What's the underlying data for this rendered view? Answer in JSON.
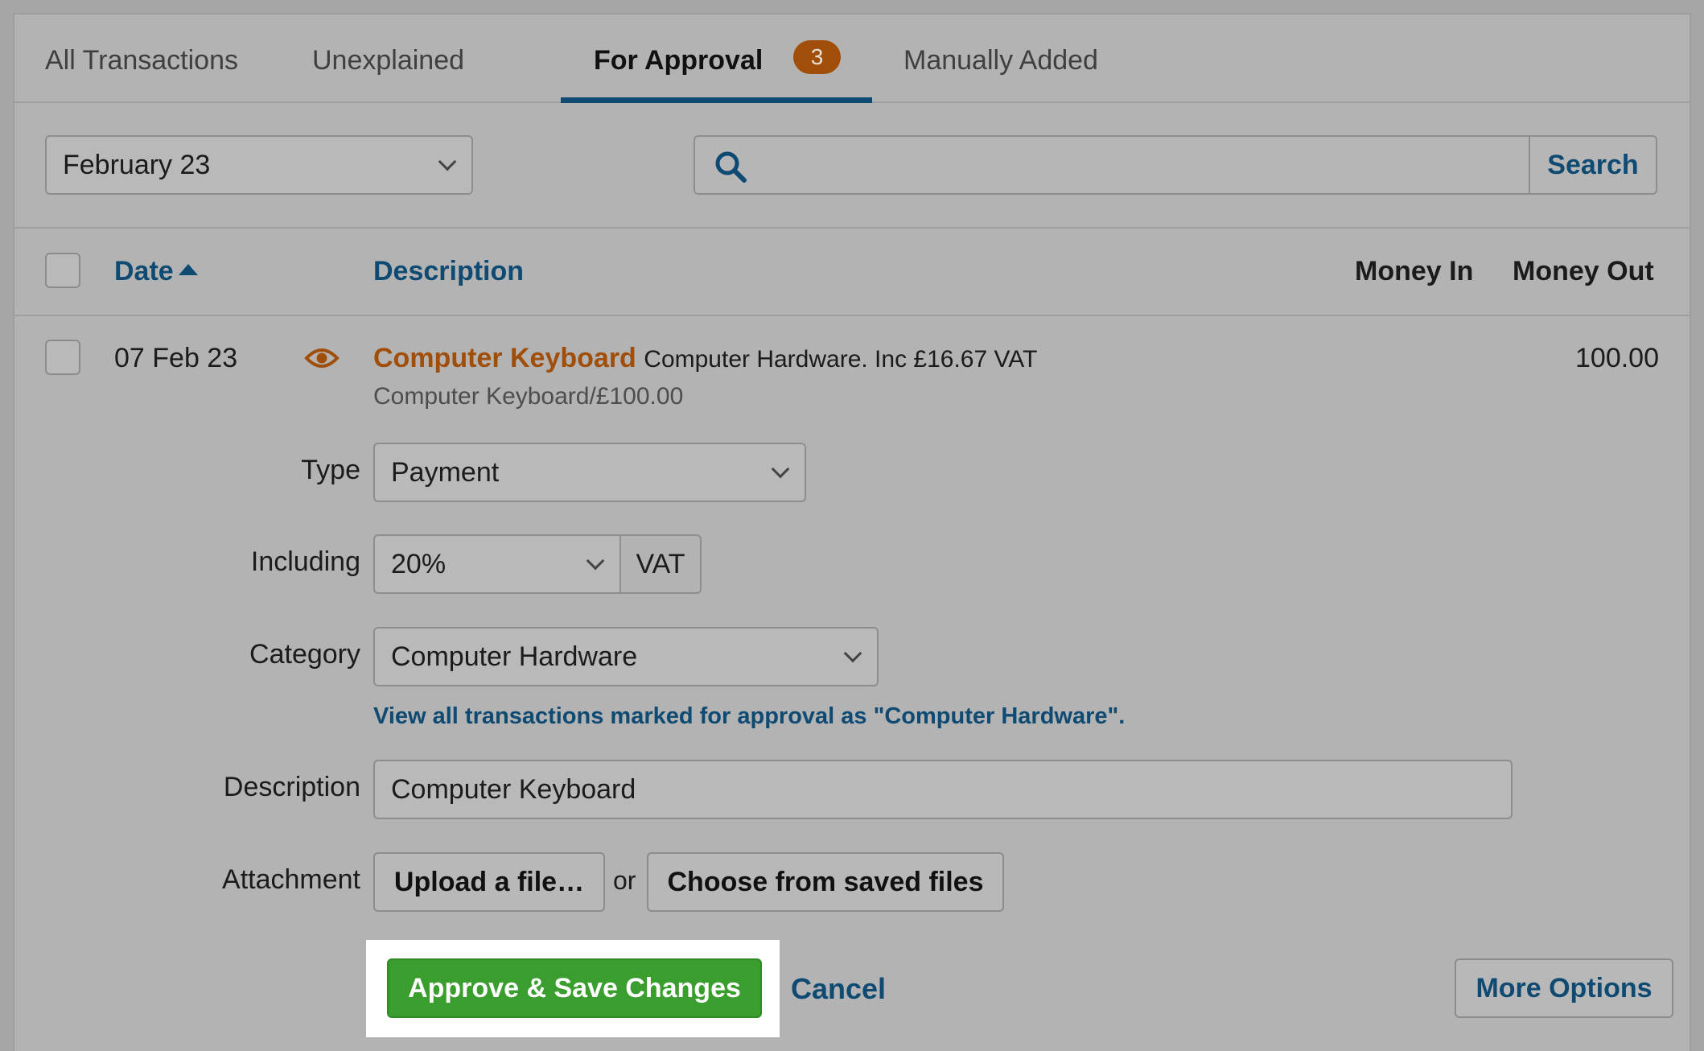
{
  "tabs": [
    {
      "label": "All Transactions"
    },
    {
      "label": "Unexplained"
    },
    {
      "label": "For Approval",
      "badge": "3"
    },
    {
      "label": "Manually Added"
    }
  ],
  "filters": {
    "period_value": "February 23",
    "search_value": "",
    "search_button": "Search"
  },
  "table": {
    "headers": {
      "date": "Date",
      "description": "Description",
      "money_in": "Money In",
      "money_out": "Money Out"
    }
  },
  "row": {
    "date": "07 Feb 23",
    "title": "Computer Keyboard",
    "subtitle": "Computer Hardware. Inc £16.67 VAT",
    "reference": "Computer Keyboard/£100.00",
    "money_out": "100.00"
  },
  "form": {
    "type_label": "Type",
    "type_value": "Payment",
    "including_label": "Including",
    "vat_rate_value": "20%",
    "vat_addon": "VAT",
    "category_label": "Category",
    "category_value": "Computer Hardware",
    "category_link": "View all transactions marked for approval as \"Computer Hardware\".",
    "description_label": "Description",
    "description_value": "Computer Keyboard",
    "attachment_label": "Attachment",
    "upload_button": "Upload a file…",
    "or_text": "or",
    "choose_button": "Choose from saved files"
  },
  "actions": {
    "approve_button": "Approve & Save Changes",
    "cancel_link": "Cancel",
    "more_options_button": "More Options"
  },
  "colors": {
    "accent_blue": "#0f4a73",
    "accent_orange": "#a14e0a",
    "approve_green": "#3a9e2e"
  }
}
